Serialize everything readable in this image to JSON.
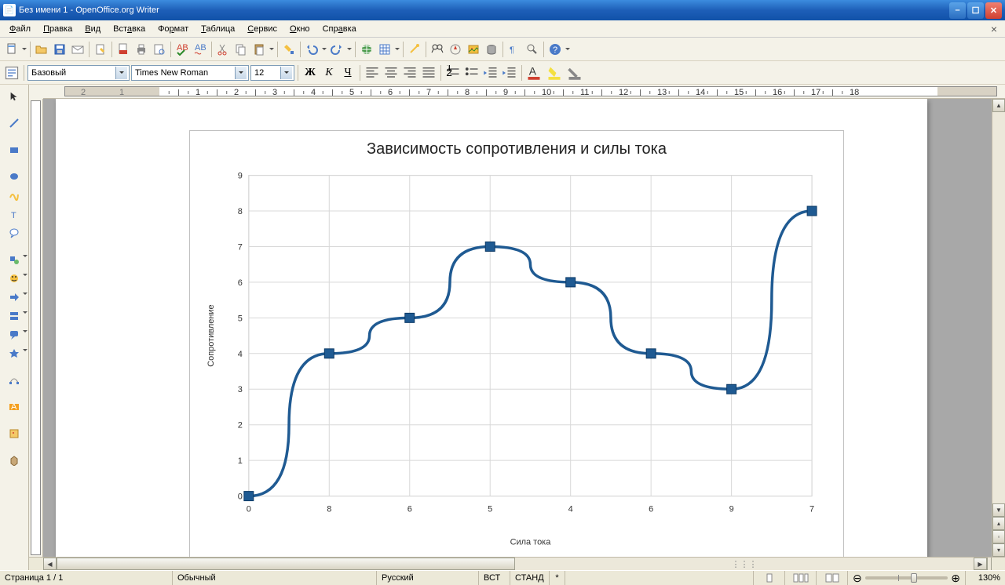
{
  "window": {
    "title": "Без имени 1 - OpenOffice.org Writer"
  },
  "menu": {
    "file": "Файл",
    "edit": "Правка",
    "view": "Вид",
    "insert": "Вставка",
    "format": "Формат",
    "table": "Таблица",
    "tools": "Сервис",
    "window": "Окно",
    "help": "Справка"
  },
  "format_bar": {
    "style": "Базовый",
    "font": "Times New Roman",
    "size": "12",
    "bold": "Ж",
    "italic": "К",
    "underline": "Ч"
  },
  "status": {
    "page": "Страница  1 / 1",
    "style": "Обычный",
    "lang": "Русский",
    "ins": "ВСТ",
    "std": "СТАНД",
    "sel": "*",
    "zoom": "130%"
  },
  "chart_data": {
    "type": "line",
    "title": "Зависимость сопротивления и силы тока",
    "xlabel": "Сила тока",
    "ylabel": "Сопротивление",
    "categories": [
      "0",
      "8",
      "6",
      "5",
      "4",
      "6",
      "9",
      "7"
    ],
    "values": [
      0,
      4,
      5,
      7,
      6,
      4,
      3,
      8
    ],
    "ylim": [
      0,
      9
    ],
    "y_ticks": [
      0,
      1,
      2,
      3,
      4,
      5,
      6,
      7,
      8,
      9
    ],
    "series_color": "#1f5a92",
    "marker": "square",
    "grid": true
  }
}
